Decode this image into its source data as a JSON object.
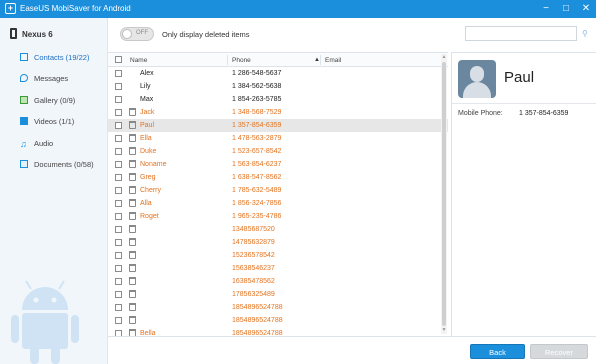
{
  "window": {
    "title": "EaseUS MobiSaver for Android",
    "app_icon": "plus-box-icon",
    "controls": [
      "−",
      "□",
      "✕"
    ]
  },
  "sidebar": {
    "device": "Nexus 6",
    "items": [
      {
        "label": "Contacts (19/22)",
        "icon": "contacts-icon",
        "active": true
      },
      {
        "label": "Messages",
        "icon": "message-icon"
      },
      {
        "label": "Gallery (0/9)",
        "icon": "gallery-icon"
      },
      {
        "label": "Videos (1/1)",
        "icon": "video-icon"
      },
      {
        "label": "Audio",
        "icon": "audio-icon"
      },
      {
        "label": "Documents (0/58)",
        "icon": "document-icon"
      }
    ]
  },
  "toolbar": {
    "toggle_state": "OFF",
    "toggle_label": "Only display deleted items",
    "search_value": ""
  },
  "list": {
    "columns": {
      "name": "Name",
      "phone": "Phone",
      "email": "Email"
    },
    "rows": [
      {
        "name": "Alex",
        "phone": "1 286-548-5637",
        "deleted": false
      },
      {
        "name": "Lily",
        "phone": "1 384-562-5638",
        "deleted": false
      },
      {
        "name": "Max",
        "phone": "1 854-263-5785",
        "deleted": false
      },
      {
        "name": "Jack",
        "phone": "1 348-568-7529",
        "deleted": true
      },
      {
        "name": "Paul",
        "phone": "1 357-854-6359",
        "deleted": true,
        "selected": true
      },
      {
        "name": "Ella",
        "phone": "1 478-563-2879",
        "deleted": true
      },
      {
        "name": "Duke",
        "phone": "1 523-657-8542",
        "deleted": true
      },
      {
        "name": "Noname",
        "phone": "1 563-854-6237",
        "deleted": true
      },
      {
        "name": "Greg",
        "phone": "1 638-547-8562",
        "deleted": true
      },
      {
        "name": "Cherry",
        "phone": "1 785-632-5489",
        "deleted": true
      },
      {
        "name": "Alla",
        "phone": "1 856-324-7856",
        "deleted": true
      },
      {
        "name": "Roget",
        "phone": "1 965-235-4786",
        "deleted": true
      },
      {
        "name": "",
        "phone": "13485687520",
        "deleted": true
      },
      {
        "name": "",
        "phone": "14785632879",
        "deleted": true
      },
      {
        "name": "",
        "phone": "15236578542",
        "deleted": true
      },
      {
        "name": "",
        "phone": "15638546237",
        "deleted": true
      },
      {
        "name": "",
        "phone": "16385478562",
        "deleted": true
      },
      {
        "name": "",
        "phone": "17856325489",
        "deleted": true
      },
      {
        "name": "",
        "phone": "18548965247​88",
        "deleted": true
      },
      {
        "name": "",
        "phone": "18548965247​88",
        "deleted": true
      },
      {
        "name": "Bella",
        "phone": "18548965247​88",
        "deleted": true
      }
    ]
  },
  "detail": {
    "name": "Paul",
    "field_label": "Mobile Phone:",
    "field_value": "1 357-854-6359"
  },
  "footer": {
    "back_label": "Back",
    "recover_label": "Recover"
  },
  "colors": {
    "accent": "#1b8fdc",
    "deleted_text": "#e4731f"
  }
}
